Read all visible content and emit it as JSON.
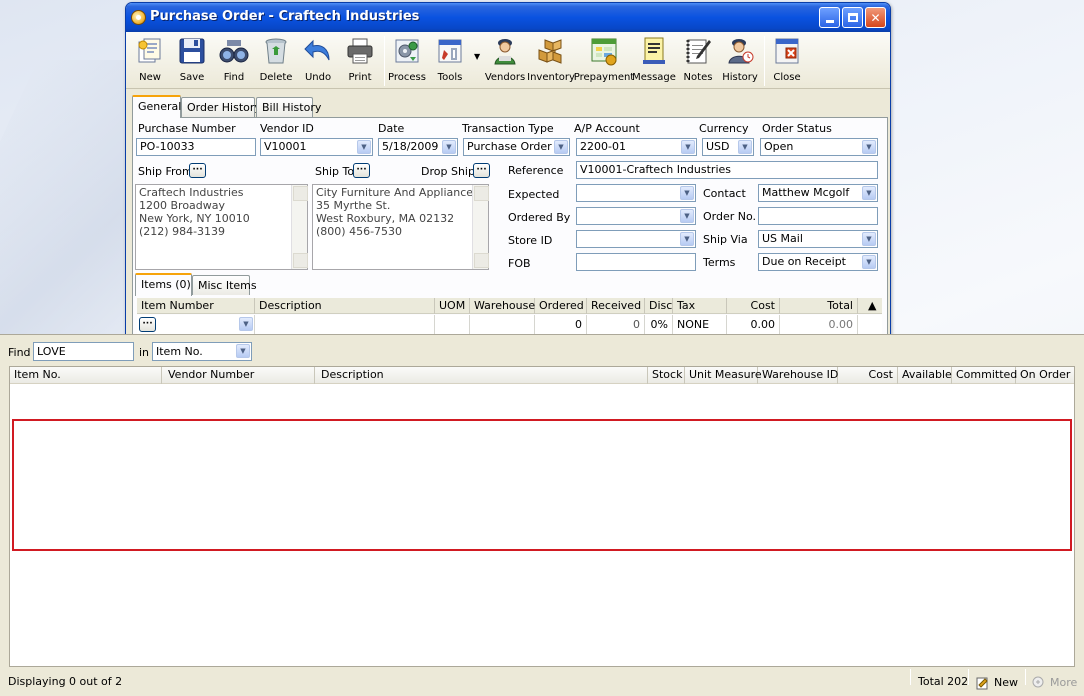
{
  "window": {
    "title": "Purchase Order - Craftech Industries"
  },
  "toolbar": {
    "new": "New",
    "save": "Save",
    "find": "Find",
    "delete": "Delete",
    "undo": "Undo",
    "print": "Print",
    "process": "Process",
    "tools": "Tools",
    "vendors": "Vendors",
    "inventory": "Inventory",
    "prepayment": "Prepayment",
    "message": "Message",
    "notes": "Notes",
    "history": "History",
    "close": "Close"
  },
  "tabs": {
    "general": "General",
    "order_history": "Order History",
    "bill_history": "Bill History"
  },
  "form": {
    "purchase_number_label": "Purchase Number",
    "purchase_number": "PO-10033",
    "vendor_id_label": "Vendor ID",
    "vendor_id": "V10001",
    "date_label": "Date",
    "date": "5/18/2009",
    "transaction_type_label": "Transaction Type",
    "transaction_type": "Purchase Order",
    "ap_account_label": "A/P Account",
    "ap_account": "2200-01",
    "currency_label": "Currency",
    "currency": "USD",
    "order_status_label": "Order Status",
    "order_status": "Open",
    "ship_from_label": "Ship From",
    "ship_to_label": "Ship To",
    "drop_ship_label": "Drop Ship",
    "ship_from": [
      "Craftech Industries",
      "1200 Broadway",
      "New York, NY 10010",
      "(212) 984-3139"
    ],
    "ship_to": [
      "City Furniture And Appliance",
      "35 Myrthe St.",
      "West Roxbury, MA 02132",
      "(800) 456-7530"
    ],
    "reference_label": "Reference",
    "reference": "V10001-Craftech Industries",
    "expected_label": "Expected",
    "expected": "",
    "ordered_by_label": "Ordered By",
    "ordered_by": "",
    "store_id_label": "Store ID",
    "store_id": "",
    "fob_label": "FOB",
    "fob": "",
    "contact_label": "Contact",
    "contact": "Matthew Mcgolf",
    "order_no_label": "Order No.",
    "order_no": "",
    "ship_via_label": "Ship Via",
    "ship_via": "US Mail",
    "terms_label": "Terms",
    "terms": "Due on Receipt"
  },
  "items_tabs": {
    "items": "Items (0)",
    "misc_items": "Misc Items"
  },
  "items_grid": {
    "headers": [
      "Item Number",
      "Description",
      "UOM",
      "Warehouse",
      "Ordered",
      "Received",
      "Disc",
      "Tax",
      "Cost",
      "Total"
    ],
    "row": {
      "item_number": "",
      "description": "",
      "uom": "",
      "warehouse": "",
      "ordered": "0",
      "received": "0",
      "disc": "0%",
      "tax": "NONE",
      "cost": "0.00",
      "total": "0.00"
    }
  },
  "find": {
    "find_label": "Find",
    "find_value": "LOVE",
    "in_label": "in",
    "in_value": "Item No.",
    "headers": [
      "Item No.",
      "Vendor Number",
      "Description",
      "Stock",
      "Unit Measure",
      "Warehouse ID",
      "Cost",
      "Available",
      "Committed",
      "On Order"
    ]
  },
  "status": {
    "displaying": "Displaying 0 out of 2",
    "total": "Total 202",
    "new": "New",
    "more": "More"
  }
}
